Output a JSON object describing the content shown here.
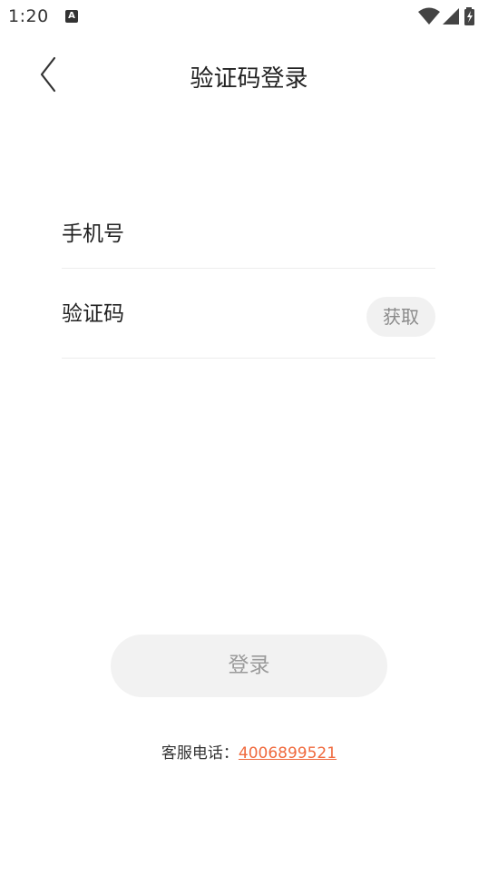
{
  "status_bar": {
    "time": "1:20",
    "notification_letter": "A",
    "icons": [
      "wifi-icon",
      "signal-icon",
      "battery-charging-icon"
    ]
  },
  "header": {
    "title": "验证码登录",
    "back_icon": "chevron-left-icon"
  },
  "form": {
    "phone_placeholder": "手机号",
    "code_placeholder": "验证码",
    "get_code_label": "获取"
  },
  "login_button_label": "登录",
  "service": {
    "label": "客服电话：",
    "phone": "4006899521"
  },
  "colors": {
    "accent_link": "#f06a3e",
    "button_bg": "#f2f2f2",
    "button_text": "#9b9b9b",
    "divider": "#ededed"
  }
}
